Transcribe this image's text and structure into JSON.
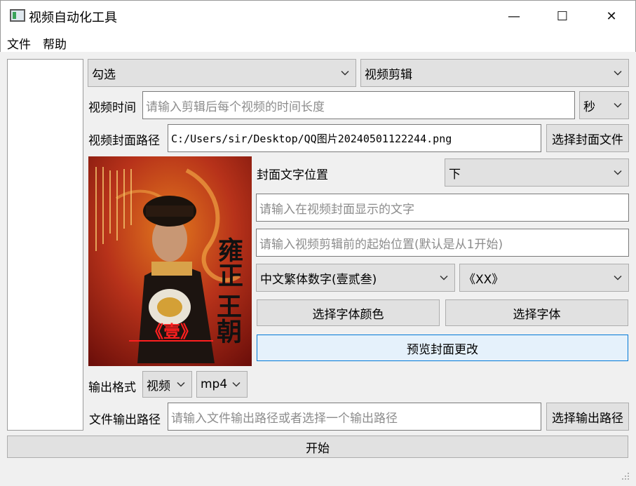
{
  "window": {
    "title": "视频自动化工具",
    "minimize_glyph": "—",
    "maximize_glyph": "☐",
    "close_glyph": "✕"
  },
  "menu": {
    "items": [
      "文件",
      "帮助"
    ]
  },
  "top": {
    "select_mode": "勾选",
    "select_function": "视频剪辑"
  },
  "duration": {
    "label": "视频时间",
    "placeholder": "请输入剪辑后每个视频的时间长度",
    "unit": "秒"
  },
  "cover_path": {
    "label": "视频封面路径",
    "value": "C:/Users/sir/Desktop/QQ图片20240501122244.png",
    "button": "选择封面文件"
  },
  "cover_image": {
    "title_art": "雍正王朝",
    "badge_art": "《壹》"
  },
  "cover_text": {
    "position_label": "封面文字位置",
    "position_value": "下",
    "text_placeholder": "请输入在视频封面显示的文字",
    "start_placeholder": "请输入视频剪辑前的起始位置(默认是从1开始)",
    "number_style": "中文繁体数字(壹贰叁)",
    "bracket_style": "《XX》",
    "font_color_button": "选择字体颜色",
    "font_button": "选择字体",
    "preview_button": "预览封面更改"
  },
  "output": {
    "format_label": "输出格式",
    "format_type": "视频",
    "format_ext": "mp4",
    "path_label": "文件输出路径",
    "path_placeholder": "请输入文件输出路径或者选择一个输出路径",
    "path_button": "选择输出路径"
  },
  "start_button": "开始",
  "colors": {
    "accent": "#0078d7",
    "focus_bg": "#e5f1fb",
    "button_bg": "#e1e1e1"
  }
}
